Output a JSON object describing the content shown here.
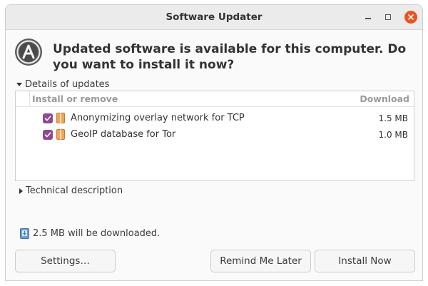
{
  "window": {
    "title": "Software Updater",
    "controls": [
      "minimize-icon",
      "maximize-icon",
      "close-icon"
    ],
    "close_color": "#e95420"
  },
  "header": {
    "icon": "software-updater-icon",
    "message": "Updated software is available for this computer. Do you want to install it now?"
  },
  "details": {
    "expander_label": "Details of updates",
    "expanded": true,
    "columns": {
      "name": "Install or remove",
      "download": "Download"
    },
    "items": [
      {
        "label": "Anonymizing overlay network for TCP",
        "size": "1.5 MB",
        "checked": true
      },
      {
        "label": "GeoIP database for Tor",
        "size": "1.0 MB",
        "checked": true
      }
    ],
    "check_color": "#8c4a8f"
  },
  "technical": {
    "expander_label": "Technical description",
    "expanded": false
  },
  "summary": {
    "download_text": "2.5 MB will be downloaded."
  },
  "buttons": {
    "settings": "Settings…",
    "remind": "Remind Me Later",
    "install": "Install Now"
  }
}
